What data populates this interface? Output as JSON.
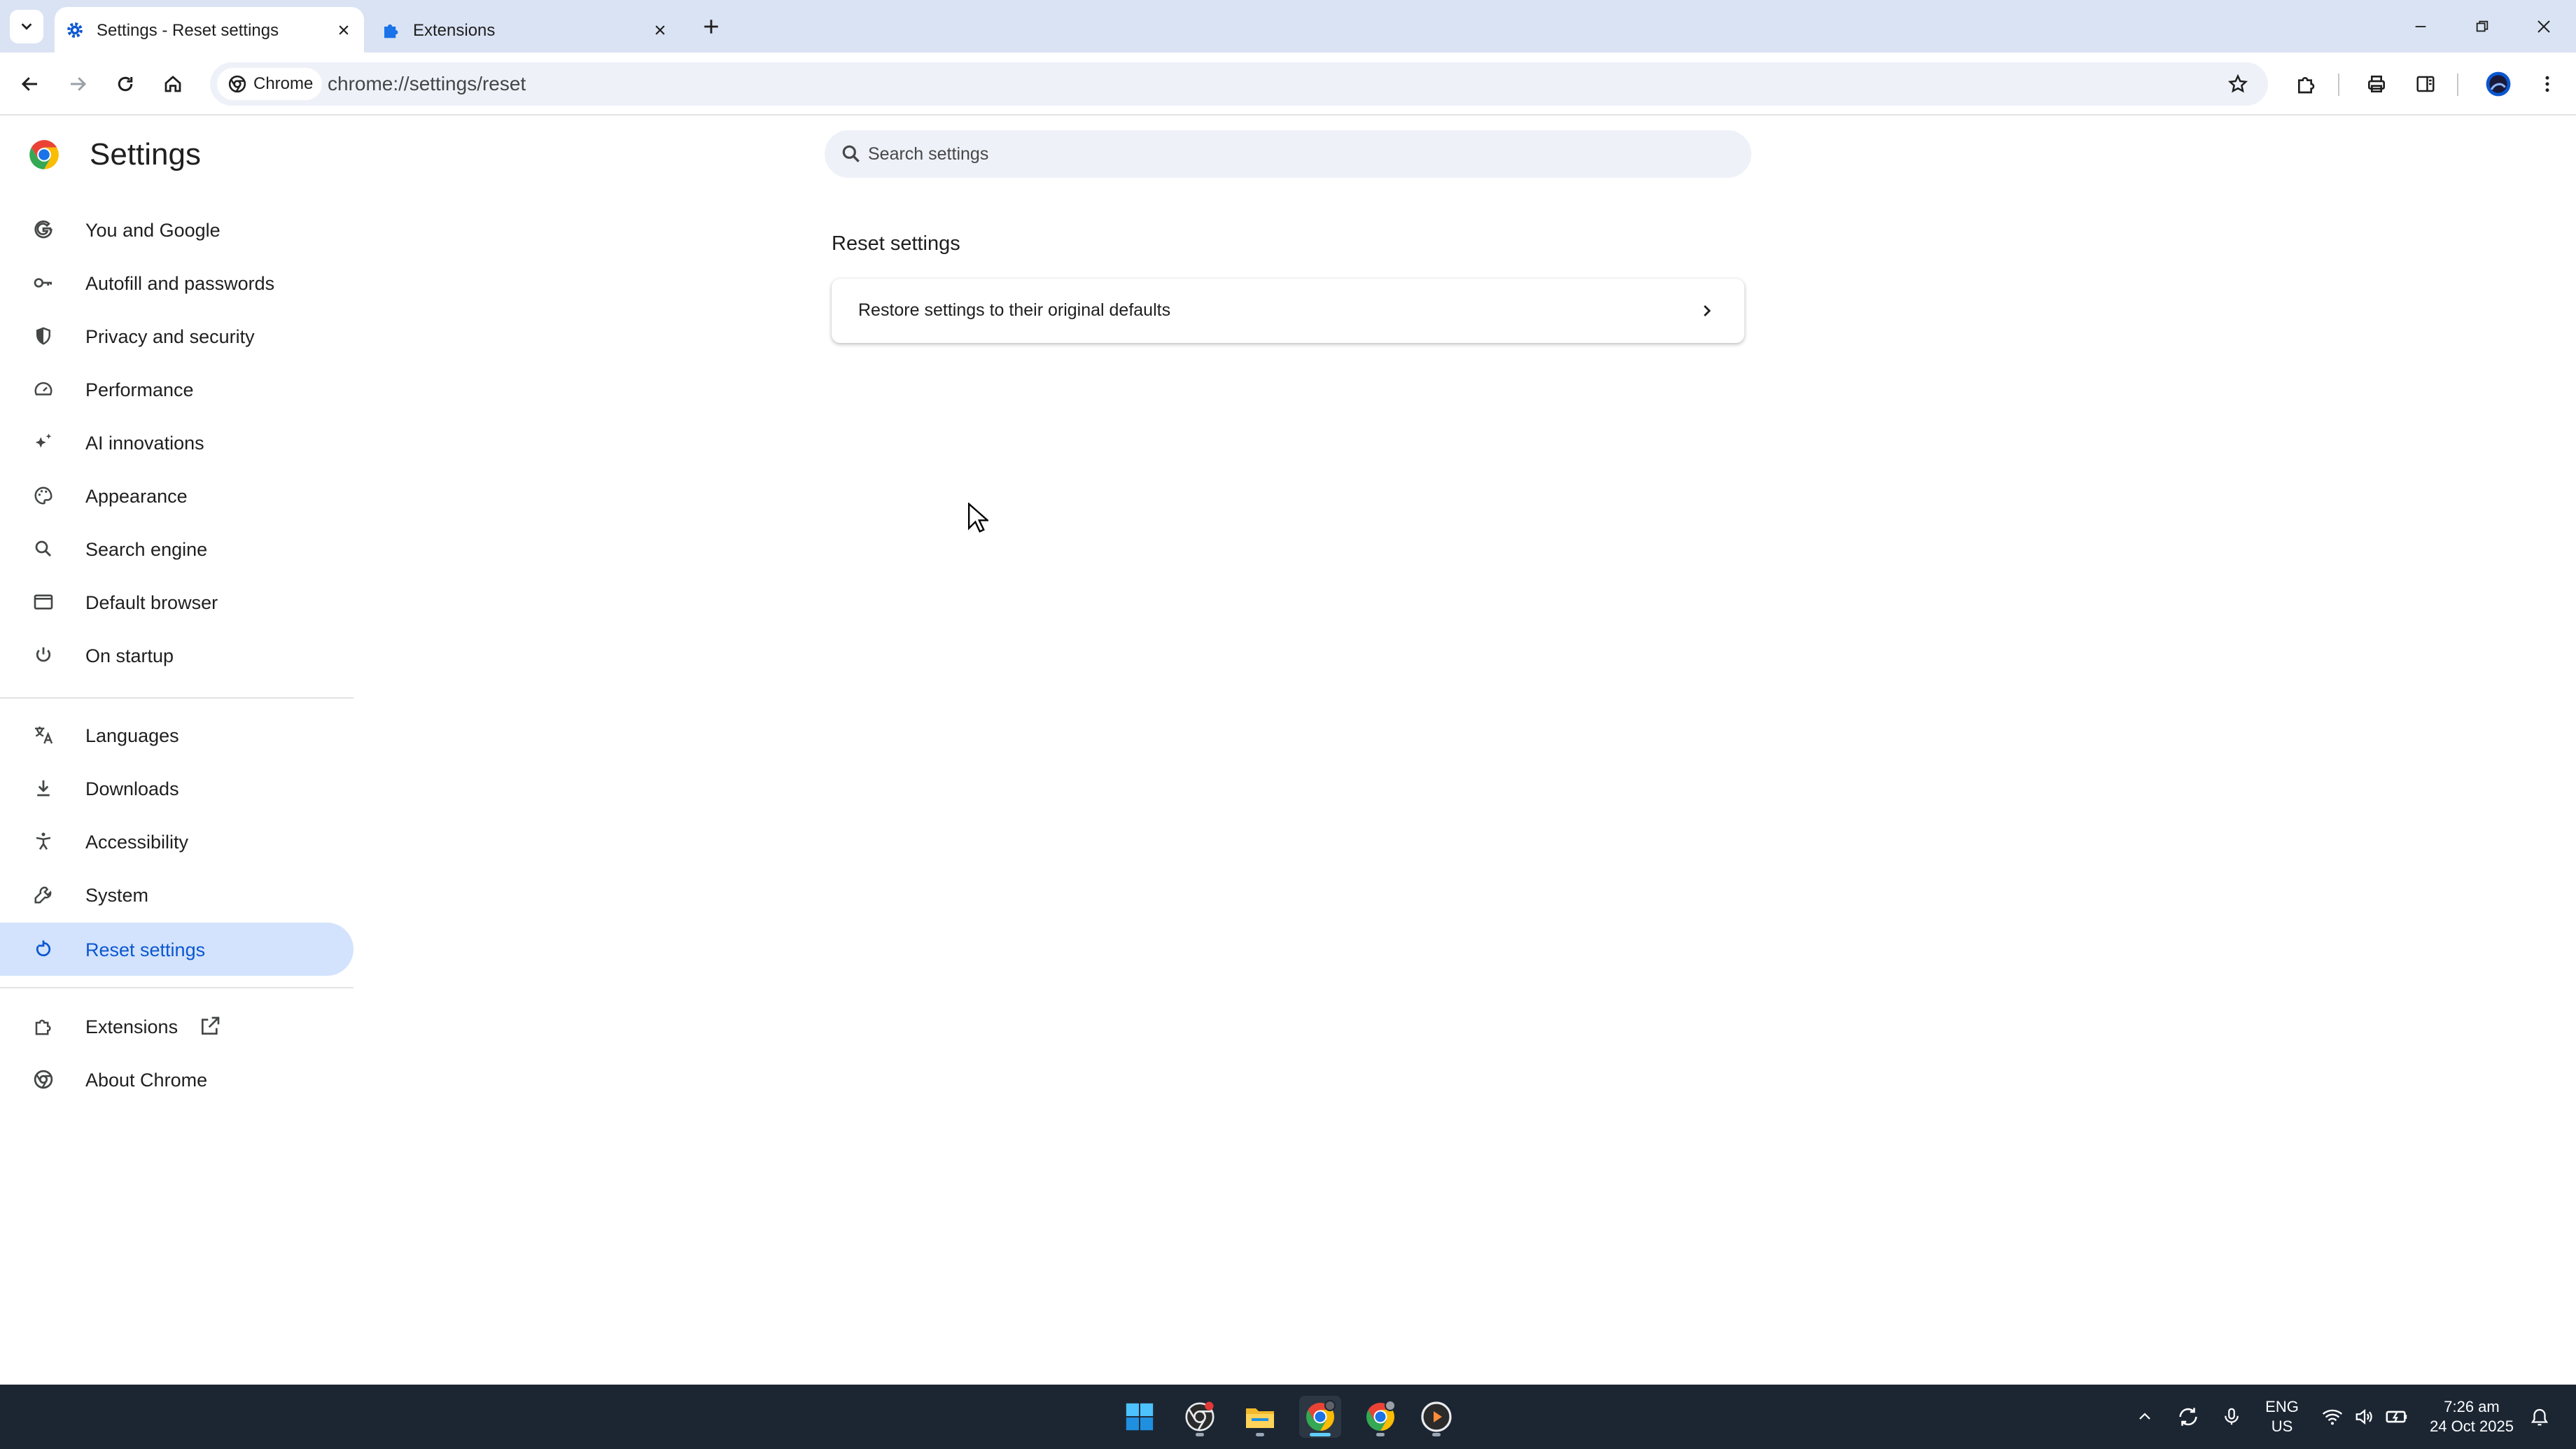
{
  "tabs": [
    {
      "title": "Settings - Reset settings",
      "active": true,
      "icon": "gear-icon"
    },
    {
      "title": "Extensions",
      "active": false,
      "icon": "puzzle-icon"
    }
  ],
  "toolbar": {
    "chip_label": "Chrome",
    "url": "chrome://settings/reset"
  },
  "settings": {
    "title": "Settings",
    "search_placeholder": "Search settings",
    "nav": [
      {
        "label": "You and Google",
        "icon": "google-g-icon"
      },
      {
        "label": "Autofill and passwords",
        "icon": "key-icon"
      },
      {
        "label": "Privacy and security",
        "icon": "shield-icon"
      },
      {
        "label": "Performance",
        "icon": "speedometer-icon"
      },
      {
        "label": "AI innovations",
        "icon": "sparkle-icon"
      },
      {
        "label": "Appearance",
        "icon": "palette-icon"
      },
      {
        "label": "Search engine",
        "icon": "search-icon"
      },
      {
        "label": "Default browser",
        "icon": "browser-window-icon"
      },
      {
        "label": "On startup",
        "icon": "power-icon"
      },
      {
        "label": "Languages",
        "icon": "translate-icon"
      },
      {
        "label": "Downloads",
        "icon": "download-icon"
      },
      {
        "label": "Accessibility",
        "icon": "accessibility-icon"
      },
      {
        "label": "System",
        "icon": "wrench-icon"
      },
      {
        "label": "Reset settings",
        "icon": "reset-icon",
        "selected": true
      },
      {
        "label": "Extensions",
        "icon": "puzzle-icon"
      },
      {
        "label": "About Chrome",
        "icon": "chrome-icon"
      }
    ],
    "section_title": "Reset settings",
    "restore_row": "Restore settings to their original defaults"
  },
  "taskbar": {
    "language": "ENG",
    "region": "US",
    "time": "7:26 am",
    "date": "24 Oct 2025"
  },
  "colors": {
    "tabstrip": "#dae3f4",
    "selected_nav": "#d3e3fd",
    "accent": "#0b57d0",
    "taskbar": "#1c2633"
  }
}
